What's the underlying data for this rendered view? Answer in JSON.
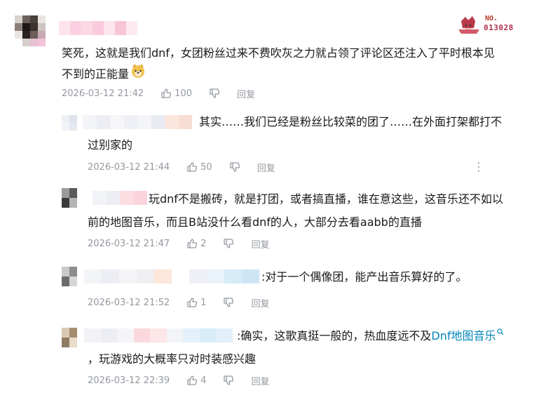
{
  "main_comment": {
    "text": "笑死，这就是我们dnf，女团粉丝过来不费吹灰之力就占领了评论区还注入了平时根本见",
    "text2": "不到的正能量",
    "emoji": "doge-emoji",
    "time": "2026-03-12 21:42",
    "likes": "100",
    "reply_label": "回复",
    "badge_no": "NO.",
    "badge_num": "013028"
  },
  "replies": [
    {
      "text": "其实……我们已经是粉丝比较菜的团了……在外面打架都打不",
      "text2": "过别家的",
      "time": "2026-03-12 21:44",
      "likes": "50",
      "reply_label": "回复"
    },
    {
      "text": "玩dnf不是搬砖，就是打团，或者搞直播，谁在意这些，这音乐还不如以",
      "text2": "前的地图音乐，而且B站没什么看dnf的人，大部分去看aabb的直播",
      "time": "2026-03-12 21:47",
      "likes": "2",
      "reply_label": "回复"
    },
    {
      "text": ":对于一个偶像团，能产出音乐算好的了。",
      "time": "2026-03-12 21:52",
      "likes": "1",
      "reply_label": "回复"
    },
    {
      "text": ":确实，这歌真挺一般的，热血度远不及",
      "link": "Dnf地图音乐",
      "text2": "，玩游戏的大概率只对时装感兴趣",
      "time": "2026-03-12 22:39",
      "likes": "4",
      "reply_label": "回复"
    }
  ],
  "colors": {
    "text": "#18191c",
    "meta": "#9499a0",
    "link": "#0085b8"
  }
}
